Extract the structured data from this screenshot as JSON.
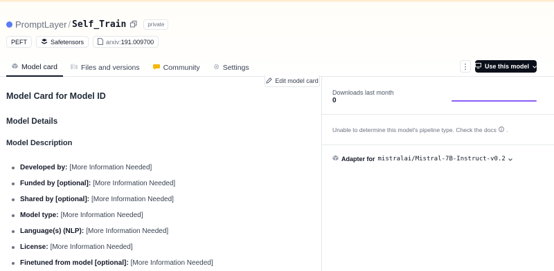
{
  "repo": {
    "org": "PromptLayer",
    "separator": "/",
    "name": "Self_Train",
    "visibility": "private"
  },
  "tags": [
    {
      "label": "PEFT",
      "icon": ""
    },
    {
      "label": "Safetensors",
      "icon": "safetensors-icon"
    },
    {
      "prefix": "arxiv:",
      "label": "191.009700",
      "icon": "document-icon"
    }
  ],
  "tabs": [
    {
      "label": "Model card",
      "icon": "cube-icon",
      "active": true
    },
    {
      "label": "Files and versions",
      "icon": "files-icon",
      "active": false
    },
    {
      "label": "Community",
      "icon": "community-icon",
      "active": false
    },
    {
      "label": "Settings",
      "icon": "gear-icon",
      "active": false
    }
  ],
  "actions": {
    "more": "⋮",
    "use_model": "Use this model",
    "edit_card": "Edit model card"
  },
  "card": {
    "title": "Model Card for Model ID",
    "details_heading": "Model Details",
    "description_heading": "Model Description",
    "items": [
      {
        "key": "Developed by:",
        "value": "[More Information Needed]"
      },
      {
        "key": "Funded by [optional]:",
        "value": "[More Information Needed]"
      },
      {
        "key": "Shared by [optional]:",
        "value": "[More Information Needed]"
      },
      {
        "key": "Model type:",
        "value": "[More Information Needed]"
      },
      {
        "key": "Language(s) (NLP):",
        "value": "[More Information Needed]"
      },
      {
        "key": "License:",
        "value": "[More Information Needed]"
      },
      {
        "key": "Finetuned from model [optional]:",
        "value": "[More Information Needed]"
      }
    ]
  },
  "sidebar": {
    "downloads_label": "Downloads last month",
    "downloads_count": "0",
    "pipeline_note": "Unable to determine this model's pipeline type. Check the docs",
    "pipeline_suffix": ".",
    "adapter_label": "Adapter for",
    "adapter_model": "mistralai/Mistral-7B-Instruct-v0.2"
  },
  "colors": {
    "accent": "#8b5cf6",
    "primary_button": "#0b0f19",
    "org_avatar": "#5b7cf3"
  }
}
